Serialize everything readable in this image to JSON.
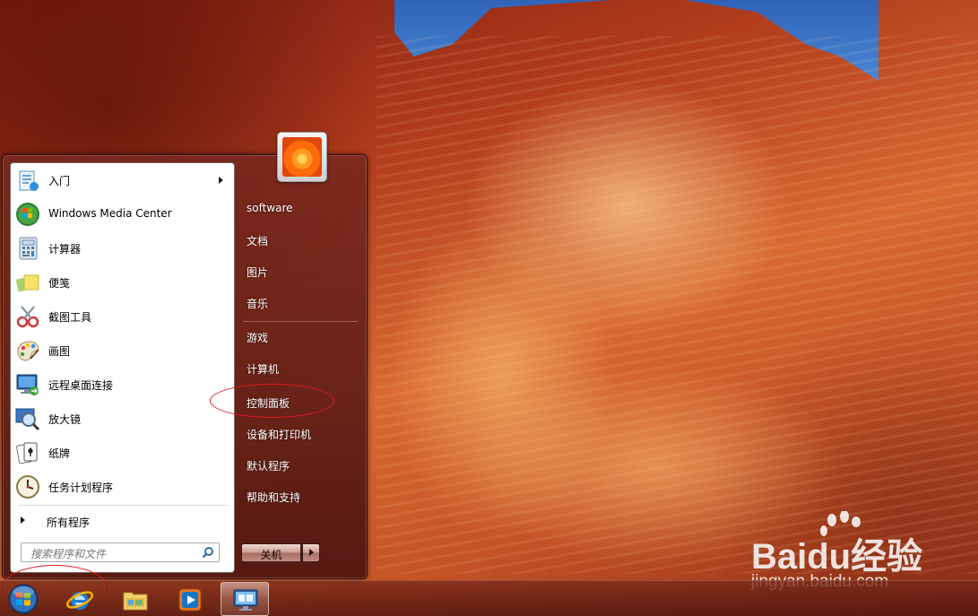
{
  "start_menu": {
    "programs": [
      {
        "label": "入门",
        "icon": "getting-started-icon",
        "has_submenu": true
      },
      {
        "label": "Windows Media Center",
        "icon": "media-center-icon",
        "has_submenu": false
      },
      {
        "label": "计算器",
        "icon": "calculator-icon",
        "has_submenu": false
      },
      {
        "label": "便笺",
        "icon": "sticky-notes-icon",
        "has_submenu": false
      },
      {
        "label": "截图工具",
        "icon": "snipping-tool-icon",
        "has_submenu": false
      },
      {
        "label": "画图",
        "icon": "paint-icon",
        "has_submenu": false
      },
      {
        "label": "远程桌面连接",
        "icon": "remote-desktop-icon",
        "has_submenu": false
      },
      {
        "label": "放大镜",
        "icon": "magnifier-icon",
        "has_submenu": false
      },
      {
        "label": "纸牌",
        "icon": "solitaire-icon",
        "has_submenu": false
      },
      {
        "label": "任务计划程序",
        "icon": "task-scheduler-icon",
        "has_submenu": false
      }
    ],
    "all_programs": "所有程序",
    "search_placeholder": "搜索程序和文件",
    "right_items": [
      {
        "label": "software"
      },
      {
        "label": "文档"
      },
      {
        "label": "图片"
      },
      {
        "label": "音乐"
      },
      {
        "label": "游戏"
      },
      {
        "label": "计算机"
      },
      {
        "label": "控制面板"
      },
      {
        "label": "设备和打印机"
      },
      {
        "label": "默认程序"
      },
      {
        "label": "帮助和支持"
      }
    ],
    "shutdown_label": "关机"
  },
  "taskbar": {
    "items": [
      {
        "name": "internet-explorer",
        "icon": "ie-icon"
      },
      {
        "name": "windows-explorer",
        "icon": "folder-icon"
      },
      {
        "name": "windows-media-player",
        "icon": "media-player-icon"
      },
      {
        "name": "remote-desktop",
        "icon": "remote-desktop-icon",
        "active": true
      }
    ]
  },
  "watermark": {
    "brand": "Baidu经验",
    "url": "jingyan.baidu.com"
  },
  "colors": {
    "annotation": "#e0191f",
    "menu_frame": "#5a1a12"
  }
}
